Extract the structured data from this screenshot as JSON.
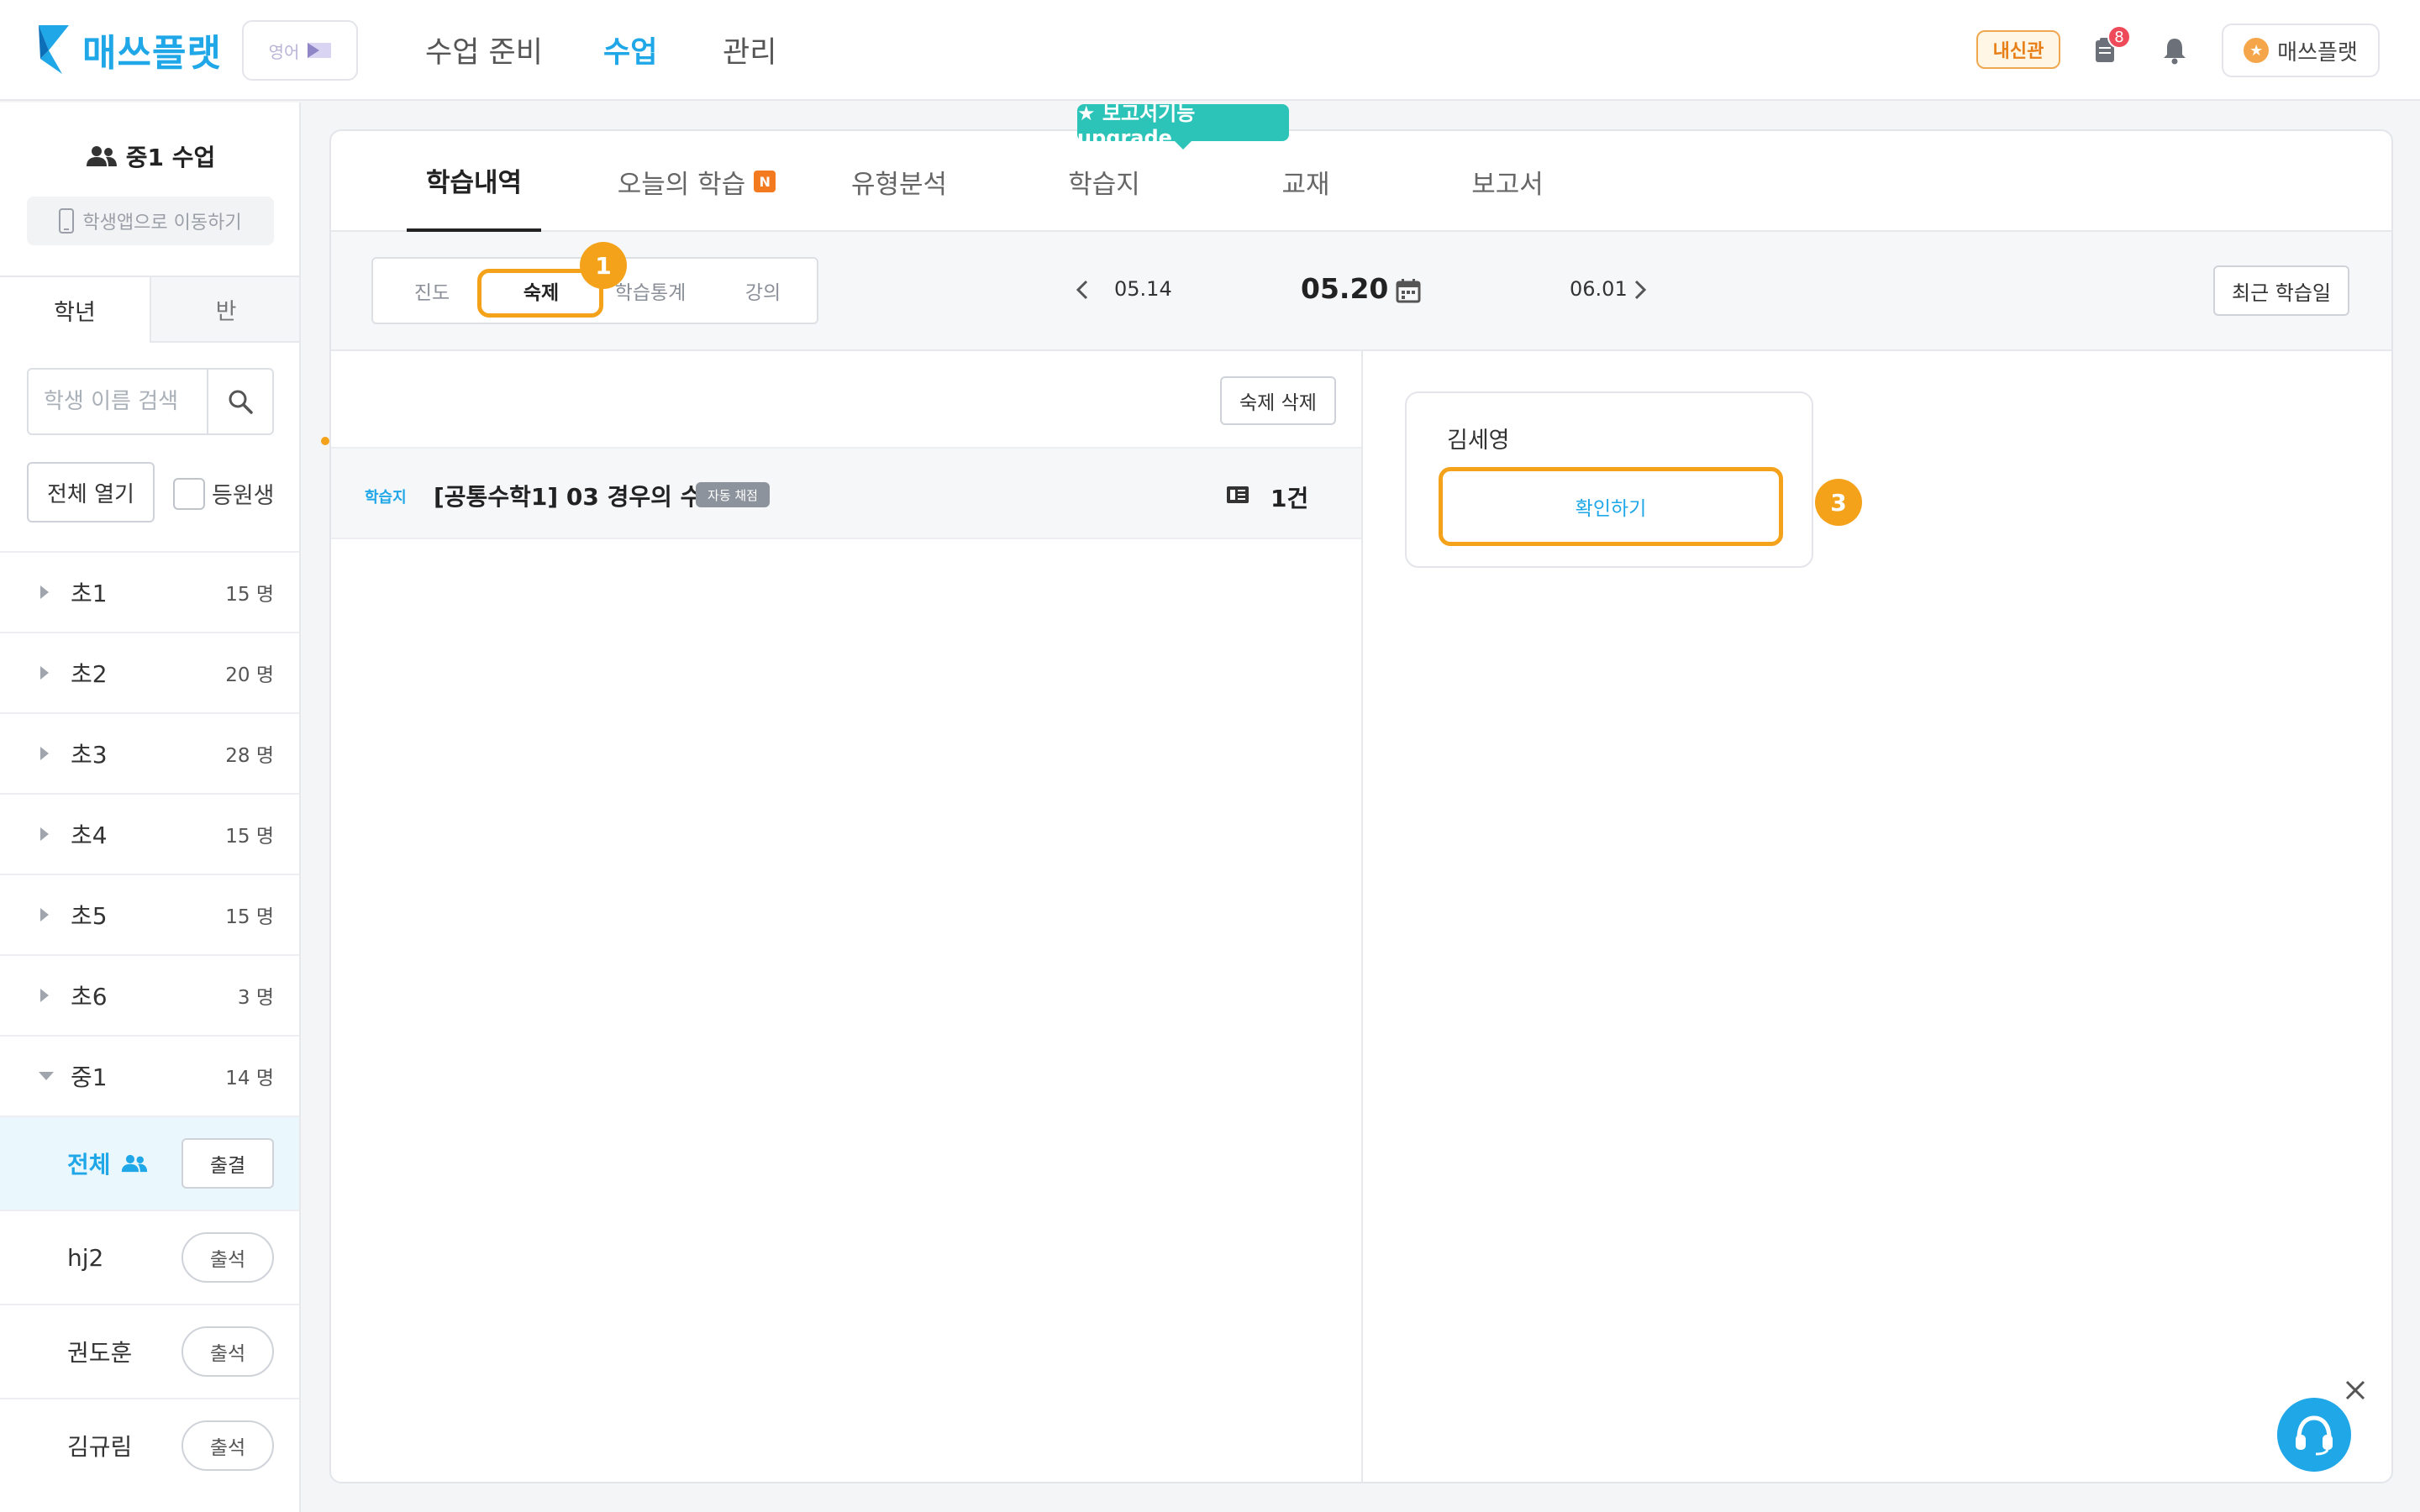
{
  "app": {
    "logo_text": "매쓰플랫",
    "lang_chip": "영어",
    "nav": [
      {
        "label": "수업 준비"
      },
      {
        "label": "수업"
      },
      {
        "label": "관리"
      }
    ],
    "naesin_label": "내신관",
    "notification_badge": "8",
    "profile_label": "매쓰플랫",
    "accent_color": "#1fa7e8",
    "highlight_color": "#f3a21a"
  },
  "sidebar": {
    "class_title": "중1 수업",
    "student_app_label": "학생앱으로 이동하기",
    "tabs": [
      "학년",
      "반"
    ],
    "search_placeholder": "학생 이름 검색",
    "open_all_label": "전체 열기",
    "enrolled_label": "등원생",
    "grades": [
      {
        "name": "초1",
        "count": "15 명"
      },
      {
        "name": "초2",
        "count": "20 명"
      },
      {
        "name": "초3",
        "count": "28 명"
      },
      {
        "name": "초4",
        "count": "15 명"
      },
      {
        "name": "초5",
        "count": "15 명"
      },
      {
        "name": "초6",
        "count": "3 명"
      },
      {
        "name": "중1",
        "count": "14 명"
      }
    ],
    "all_label": "전체",
    "all_button": "출결",
    "students": [
      {
        "name": "hj2",
        "button": "출석"
      },
      {
        "name": "권도훈",
        "button": "출석"
      },
      {
        "name": "김규림",
        "button": "출석"
      }
    ]
  },
  "main": {
    "tabs": [
      {
        "label": "학습내역"
      },
      {
        "label": "오늘의 학습",
        "badge": "N"
      },
      {
        "label": "유형분석"
      },
      {
        "label": "학습지"
      },
      {
        "label": "교재"
      },
      {
        "label": "보고서"
      }
    ],
    "upgrade_tooltip": "★ 보고서기능 upgrade",
    "segments": [
      "진도",
      "숙제",
      "학습통계",
      "강의"
    ],
    "dates": {
      "prev": "05.14",
      "current": "05.20",
      "next": "06.01"
    },
    "recent_button": "최근 학습일",
    "homework_delete": "숙제 삭제",
    "homework": {
      "type": "학습지",
      "title": "[공통수학1] 03 경우의 수1",
      "badge": "자동 채점",
      "count": "1건"
    },
    "student_card": {
      "name": "김세영",
      "confirm": "확인하기"
    },
    "steps": [
      "1",
      "3"
    ]
  }
}
